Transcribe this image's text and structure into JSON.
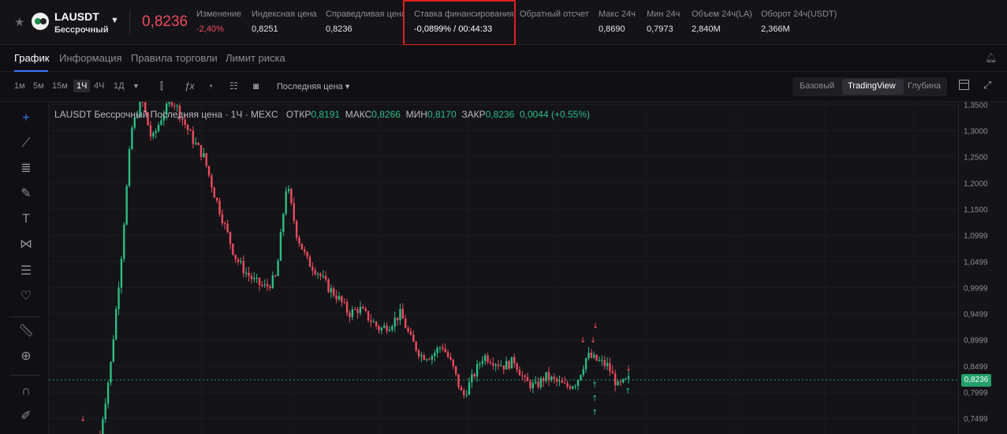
{
  "ticker": {
    "symbol": "LAUSDT",
    "contract_type": "Бессрочный",
    "last_price": "0,8236",
    "stats": [
      {
        "label": "Изменение",
        "value": "-2,40%"
      },
      {
        "label": "Индексная цена",
        "value": "0,8251"
      },
      {
        "label": "Справедливая цена",
        "value": "0,8236"
      },
      {
        "label": "Ставка финансирования",
        "value": "-0,0899%  /  00:44:33"
      },
      {
        "label": "Обратный отсчет",
        "value": ""
      },
      {
        "label": "Макс 24ч",
        "value": "0,8690"
      },
      {
        "label": "Мин 24ч",
        "value": "0,7973"
      },
      {
        "label": "Объем 24ч(LA)",
        "value": "2,840M"
      },
      {
        "label": "Оборот 24ч(USDT)",
        "value": "2,366M"
      }
    ],
    "change_color": "#ee4b5e",
    "highlight_color": "#e02020"
  },
  "tabs": [
    "График",
    "Информация",
    "Правила торговли",
    "Лимит риска"
  ],
  "toolbar": {
    "timeframes": [
      "1м",
      "5м",
      "15м",
      "1Ч",
      "4Ч",
      "1Д"
    ],
    "active_timeframe": "1Ч",
    "price_type": "Последняя цена",
    "views": [
      "Базовый",
      "TradingView",
      "Глубина"
    ],
    "active_view": "TradingView"
  },
  "draw_tools": [
    "crosshair-icon",
    "trend-line-icon",
    "fib-lines-icon",
    "brush-icon",
    "text-icon",
    "pattern-icon",
    "parallel-channel-icon",
    "heart-icon",
    "ruler-icon",
    "zoom-in-icon",
    "magnet-icon",
    "lock-pencil-icon"
  ],
  "legend": {
    "title": "LAUSDT Бессрочный Последняя цена · 1Ч · MEXC",
    "open_label": "ОТКР",
    "open": "0,8191",
    "high_label": "МАКС",
    "high": "0,8266",
    "low_label": "МИН",
    "low": "0,8170",
    "close_label": "ЗАКР",
    "close": "0,8236",
    "change": "0,0044 (+0.55%)"
  },
  "chart_data": {
    "type": "candlestick",
    "title": "LAUSDT Бессрочный Последняя цена · 1Ч · MEXC",
    "y_ticks": [
      "1,3500",
      "1,3000",
      "1,2500",
      "1,2000",
      "1,1500",
      "1,0999",
      "1,0499",
      "0,9999",
      "0,9499",
      "0,8999",
      "0,8499",
      "0,7999",
      "0,7499"
    ],
    "ylim": [
      0.72,
      1.355
    ],
    "current_price": "0,8236",
    "current_price_value": 0.8236,
    "up_color": "#2dbd85",
    "down_color": "#ee4b5e",
    "approx_close_path": [
      0.72,
      0.85,
      1.05,
      1.3,
      1.36,
      1.28,
      1.33,
      1.36,
      1.32,
      1.28,
      1.25,
      1.18,
      1.12,
      1.06,
      1.03,
      1.01,
      1.0,
      1.02,
      1.2,
      1.1,
      1.05,
      1.03,
      1.0,
      0.98,
      0.95,
      0.96,
      0.94,
      0.92,
      0.93,
      0.95,
      0.9,
      0.87,
      0.87,
      0.89,
      0.85,
      0.79,
      0.83,
      0.87,
      0.86,
      0.85,
      0.86,
      0.82,
      0.81,
      0.83,
      0.82,
      0.81,
      0.82,
      0.87,
      0.86,
      0.85,
      0.81,
      0.8236
    ]
  }
}
